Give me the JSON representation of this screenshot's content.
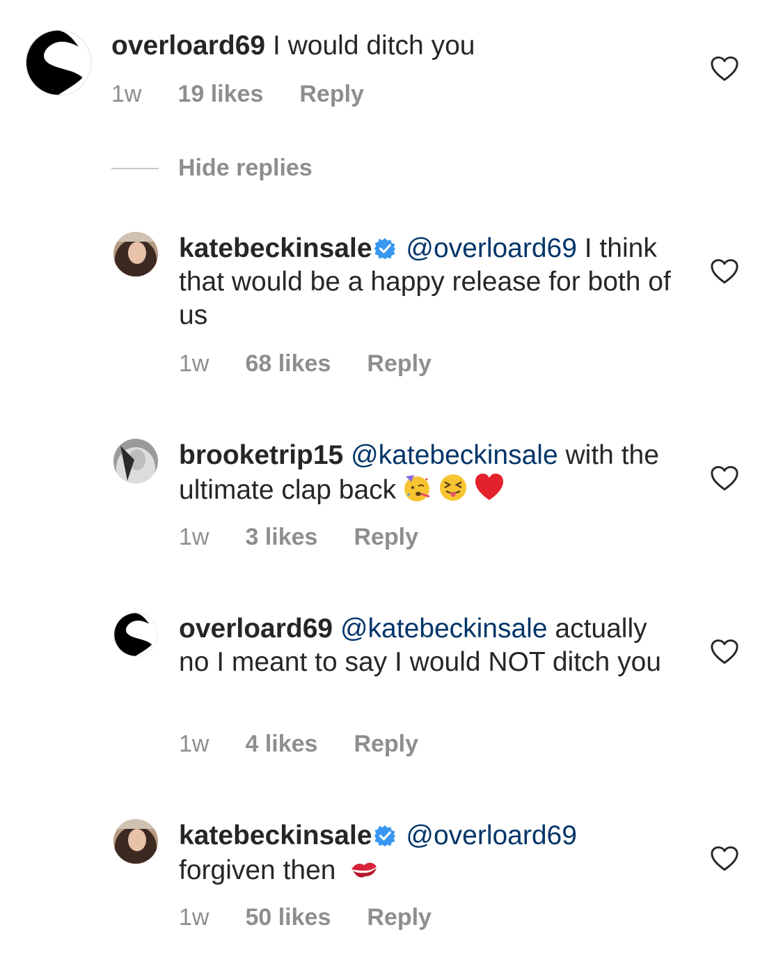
{
  "comments": [
    {
      "username": "overloard69",
      "mention": "",
      "text": "I would ditch you",
      "time": "1w",
      "likes": "19 likes",
      "reply": "Reply",
      "verified": false,
      "avatar": "logo-avatar"
    }
  ],
  "hide_replies": "Hide replies",
  "replies": [
    {
      "username": "katebeckinsale",
      "verified": true,
      "mention": "@overloard69",
      "text": "I think that would be a happy release for both of us",
      "time": "1w",
      "likes": "68 likes",
      "reply": "Reply",
      "avatar": "photo-avatar"
    },
    {
      "username": "brooketrip15",
      "verified": false,
      "mention": "@katebeckinsale",
      "text": "with the ultimate clap back",
      "emojis": [
        "partying-face-emoji",
        "squinting-tongue-emoji",
        "red-heart-emoji"
      ],
      "time": "1w",
      "likes": "3 likes",
      "reply": "Reply",
      "avatar": "photo-avatar-bw"
    },
    {
      "username": "overloard69",
      "verified": false,
      "mention": "@katebeckinsale",
      "text": "actually no I meant to say I would NOT ditch you",
      "time": "1w",
      "likes": "4 likes",
      "reply": "Reply",
      "avatar": "logo-avatar"
    },
    {
      "username": "katebeckinsale",
      "verified": true,
      "mention": "@overloard69",
      "text": "forgiven then",
      "emojis": [
        "kiss-mark-emoji"
      ],
      "time": "1w",
      "likes": "50 likes",
      "reply": "Reply",
      "avatar": "photo-avatar"
    }
  ],
  "colors": {
    "text": "#262626",
    "mention": "#003569",
    "meta": "#8e8e8e",
    "verified": "#3897f0"
  }
}
